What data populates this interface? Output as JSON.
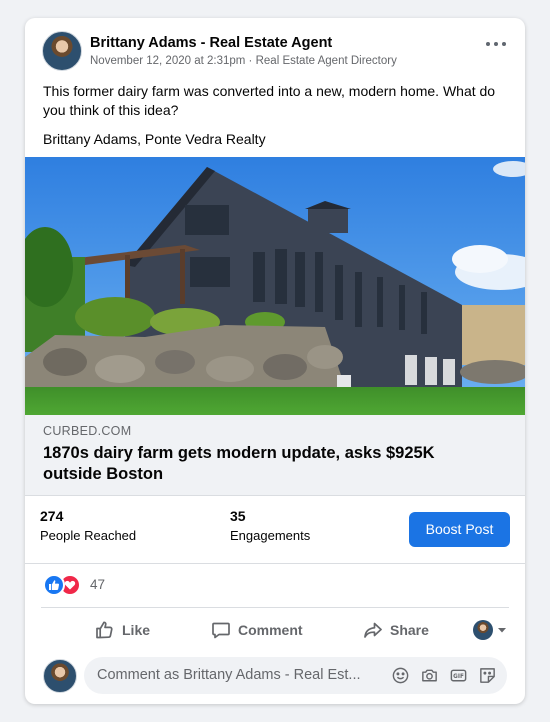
{
  "post": {
    "author": "Brittany Adams - Real Estate Agent",
    "timestamp": "November 12, 2020 at 2:31pm",
    "separator": " · ",
    "source": "Real Estate Agent Directory",
    "text_line1": "This former dairy farm was converted into a new, modern home. What do you think of this idea?",
    "text_line2": "Brittany Adams, Ponte Vedra Realty"
  },
  "link": {
    "domain": "CURBED.COM",
    "title": "1870s dairy farm gets modern update, asks $925K outside Boston"
  },
  "stats": {
    "reached_value": "274",
    "reached_label": "People Reached",
    "engagements_value": "35",
    "engagements_label": "Engagements",
    "boost_label": "Boost Post"
  },
  "reactions": {
    "count": "47",
    "types": [
      "like-icon",
      "love-icon"
    ]
  },
  "actions": {
    "like": "Like",
    "comment": "Comment",
    "share": "Share"
  },
  "comment": {
    "placeholder": "Comment as Brittany Adams - Real Est..."
  },
  "colors": {
    "brand_blue": "#1b74e4",
    "like_blue": "#1877f2",
    "love_red": "#f02849",
    "secondary_text": "#65676b"
  },
  "icons": [
    "more-options-icon",
    "like-thumb-icon",
    "comment-bubble-icon",
    "share-arrow-icon",
    "chevron-down-icon",
    "emoji-icon",
    "camera-icon",
    "gif-icon",
    "sticker-icon"
  ]
}
